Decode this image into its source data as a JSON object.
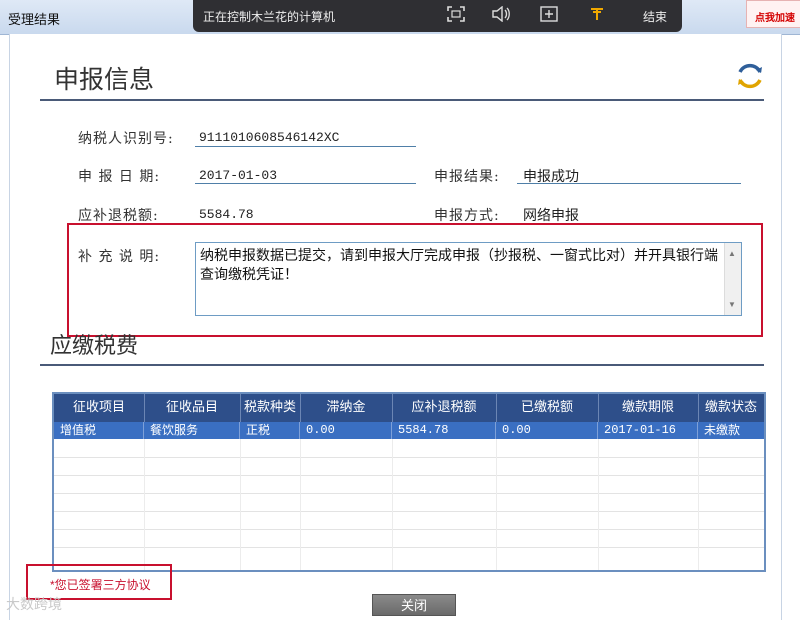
{
  "window": {
    "title": "受理结果"
  },
  "remote_bar": {
    "title": "正在控制木兰花的计算机",
    "end_label": "结束",
    "icons": [
      "fullscreen-icon",
      "volume-icon",
      "screenshot-icon",
      "pin-icon"
    ]
  },
  "promo": {
    "text": "点我加速"
  },
  "header": {
    "title": "申报信息"
  },
  "form": {
    "taxpayer_id_label": "纳税人识别号:",
    "taxpayer_id_value": "9111010608546142XC",
    "declare_date_label": "申 报 日 期:",
    "declare_date_value": "2017-01-03",
    "declare_result_label": "申报结果:",
    "declare_result_value": "申报成功",
    "refund_amount_label": "应补退税额:",
    "refund_amount_value": "5584.78",
    "declare_method_label": "申报方式:",
    "declare_method_value": "网络申报",
    "note_label": "补 充 说 明:",
    "note_value": "纳税申报数据已提交，请到申报大厅完成申报（抄报税、一窗式比对）并开具银行端查询缴税凭证！"
  },
  "tax_section": {
    "title": "应缴税费"
  },
  "table": {
    "columns": [
      "征收项目",
      "征收品目",
      "税款种类",
      "滞纳金",
      "应补退税额",
      "已缴税额",
      "缴款期限",
      "缴款状态"
    ],
    "rows": [
      [
        "增值税",
        "餐饮服务",
        "正税",
        "0.00",
        "5584.78",
        "0.00",
        "2017-01-16",
        "未缴款"
      ]
    ]
  },
  "footer": {
    "agreement_note": "*您已签署三方协议",
    "close_label": "关闭",
    "watermark": "大数跨境"
  },
  "colors": {
    "accent_red": "#c8102e",
    "header_blue": "#2e4f8a",
    "row_selected": "#3a6fc2"
  }
}
